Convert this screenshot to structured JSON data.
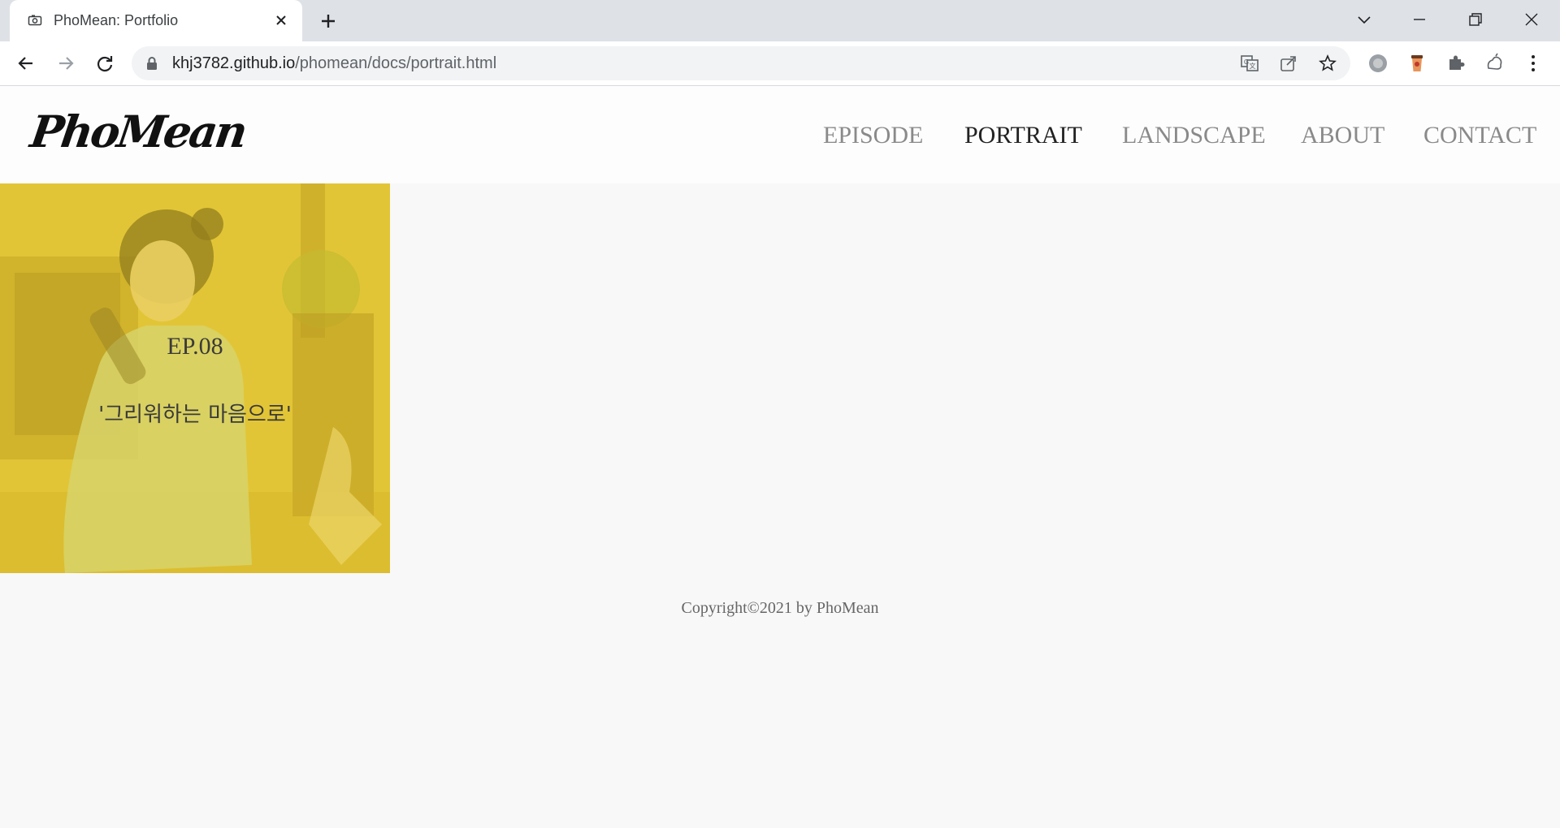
{
  "browser": {
    "tab_title": "PhoMean: Portfolio",
    "url_host": "khj3782.github.io",
    "url_path": "/phomean/docs/portrait.html"
  },
  "site": {
    "logo": "PhoMean",
    "nav": [
      {
        "label": "EPISODE",
        "active": false
      },
      {
        "label": "PORTRAIT",
        "active": true
      },
      {
        "label": "LANDSCAPE",
        "active": false
      },
      {
        "label": "ABOUT",
        "active": false
      },
      {
        "label": "CONTACT",
        "active": false
      }
    ]
  },
  "gallery": {
    "items": [
      {
        "episode": "EP.08",
        "subtitle": "'그리워하는 마음으로'"
      }
    ]
  },
  "footer": {
    "copyright": "Copyright©2021 by PhoMean"
  },
  "colors": {
    "overlay": "#e6c828",
    "chrome_bg": "#dee1e6",
    "active_nav": "#222222",
    "inactive_nav": "#8a8a8a"
  }
}
